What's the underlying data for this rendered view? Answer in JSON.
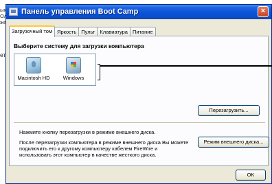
{
  "background_window": {
    "lines": [
      "ыю",
      "Ол",
      "жен",
      "ети"
    ]
  },
  "window": {
    "title": "Панель управления Boot Camp",
    "close_glyph": "×"
  },
  "tabs": [
    {
      "label": "Загрузочный том",
      "active": true
    },
    {
      "label": "Яркость",
      "active": false
    },
    {
      "label": "Пульт",
      "active": false
    },
    {
      "label": "Клавиатура",
      "active": false
    },
    {
      "label": "Питание",
      "active": false
    }
  ],
  "startup": {
    "heading": "Выберите систему для загрузки компьютера",
    "volumes": [
      {
        "label": "Macintosh HD",
        "icon": "mac-drive-icon"
      },
      {
        "label": "Windows",
        "icon": "windows-drive-icon"
      }
    ],
    "restart_button": "Перезагрузить..."
  },
  "target_disk": {
    "info": "Нажмите кнопку перезагрузки в режиме внешнего диска.",
    "description": "После перезагрузки компьютера в режиме внешнего диска Вы можете подключить его к другому компьютеру кабелем FireWire и использовать этот компьютер в качестве жесткого диска.",
    "button": "Режим внешнего диска..."
  },
  "footer": {
    "ok_button": "OK"
  }
}
